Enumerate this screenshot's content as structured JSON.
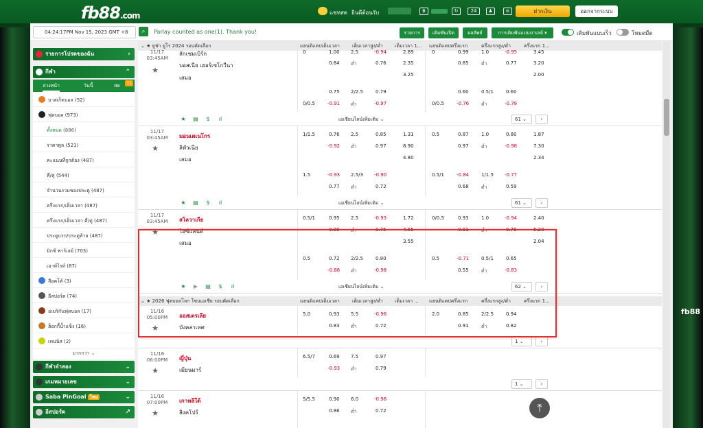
{
  "header": {
    "logo": "fb88",
    "logo_suffix": ".com",
    "chat_label": "แชทสด",
    "welcome": "ยินดีต้อนรับ",
    "deposit": "ฝากเงิน",
    "logout": "ออกจากระบบ"
  },
  "topbar": {
    "time": "04:24:17PM Nov 15, 2023 GMT +8",
    "parlay_msg": "Parlay counted as one(1). Thank you!",
    "btn_rules": "รายการ",
    "btn_open": "เดิมพันเปิด",
    "btn_results": "ผลลัพธ์",
    "btn_bet_type": "การเดิมพันแบบมาเลย์",
    "toggle_fast": "เดิมพันแบบเร็ว",
    "toggle_dark": "โหมดมืด"
  },
  "sidebar": {
    "fav_list": "รายการโปรดของฉัน",
    "sports": "กีฬา",
    "tabs": [
      "ล่วงหน้า",
      "วันนี้",
      "สด"
    ],
    "live_count": "11",
    "rows": [
      {
        "label": "บาสเก็ตบอล",
        "count": "(52)"
      },
      {
        "label": "ฟุตบอล",
        "count": "(973)"
      },
      {
        "label": "ทั้งหมด",
        "count": "(886)"
      },
      {
        "label": "ราคาพูล",
        "count": "(521)"
      },
      {
        "label": "คะแนนที่ถูกต้อง",
        "count": "(487)"
      },
      {
        "label": "คี่/คู่",
        "count": "(544)"
      },
      {
        "label": "จำนวนรวมของประตู",
        "count": "(487)"
      },
      {
        "label": "ครึ่งแรก/เต็มเวลา",
        "count": "(487)"
      },
      {
        "label": "ครึ่งแรก/เต็มเวลา คี่/คู่",
        "count": "(487)"
      },
      {
        "label": "ประตูแรก/ประตูท้าย",
        "count": "(487)"
      },
      {
        "label": "มิกซ์ พาร์เลย์",
        "count": "(703)"
      },
      {
        "label": "เอาท์ไรท์",
        "count": "(87)"
      },
      {
        "label": "ลีอคโต้",
        "count": "(3)"
      },
      {
        "label": "อีสปอร์ต",
        "count": "(74)"
      },
      {
        "label": "อเมริกันฟุตบอล",
        "count": "(17)"
      },
      {
        "label": "ฮ็อกกี้น้ำแข็ง",
        "count": "(16)"
      },
      {
        "label": "เทนนิส",
        "count": "(2)"
      }
    ],
    "more": "มากกว่า",
    "virtual": "กีฬาจำลอง",
    "number_game": "เกมหมายเลข",
    "saba": "Saba PinGoal",
    "saba_badge": "ใหม่",
    "esports": "อีสปอร์ต"
  },
  "odds": {
    "league1": "ยูฟ่า ยูโร 2024 รอบคัดเลือก",
    "league2": "2026 ฟุตบอลโลก โซนเอเชีย รอบคัดเลือก",
    "col_heads": [
      "แฮนดิแคปเต็มเวลา",
      "เต็มเวลาสูง/ต่ำ",
      "เต็มเวลา 1...",
      "แฮนดิแคปครึ่งแรก",
      "ครึ่งแรกสูง/ต่ำ",
      "ครึ่งแรก 1..."
    ],
    "col_heads2": [
      "แฮนดิแคปเต็มเวลา",
      "เต็มเวลาสูง/ต่ำ",
      "เต็มเวลา ...",
      "แฮนดิแคปครึ่งแรก",
      "ครึ่งแรกสูง/ต่ำ",
      "ครึ่งแรก 1..."
    ],
    "low": "ต่ำ",
    "draw": "เสมอ",
    "more_bets": "เอเชียนไลน์เพิ่มเติม",
    "m0": {
      "time": "11/17",
      "clock": "03:45AM",
      "home": "ลักเซมเบิร์ก",
      "away": "บอสเนีย เฮอร์เซโกวีนา",
      "r1": [
        "0",
        "1.00",
        "2.5",
        "-0.94",
        "2.89",
        "0",
        "0.99",
        "1.0",
        "-0.95",
        "3.45"
      ],
      "r2": [
        "0.84",
        "0.76",
        "2.35",
        "0.85",
        "0.77",
        "3.20"
      ],
      "r3": [
        "3.25",
        "2.00"
      ],
      "a1": [
        "0.75",
        "2/2.5",
        "0.79",
        "0.60",
        "0.5/1",
        "0.60"
      ],
      "a2": [
        "0/0.5",
        "-0.91",
        "-0.97",
        "0/0.5",
        "-0.76",
        "-0.78"
      ],
      "count": "61"
    },
    "m1": {
      "time": "11/17",
      "clock": "03:45AM",
      "home": "มอนเตเนโกร",
      "away": "ลิทัวเนีย",
      "r1": [
        "1/1.5",
        "0.76",
        "2.5",
        "0.85",
        "1.31",
        "0.5",
        "0.87",
        "1.0",
        "0.80",
        "1.87"
      ],
      "r2": [
        "-0.92",
        "0.97",
        "8.90",
        "0.97",
        "-0.98",
        "7.30"
      ],
      "r3": [
        "4.80",
        "2.34"
      ],
      "a1": [
        "1.5",
        "-0.93",
        "2.5/3",
        "-0.90",
        "0.5/1",
        "-0.84",
        "1/1.5",
        "-0.77"
      ],
      "a2": [
        "0.77",
        "0.72",
        "0.68",
        "0.59"
      ],
      "count": "61"
    },
    "m2": {
      "time": "11/17",
      "clock": "03:45AM",
      "home": "สโลวาเกีย",
      "away": "ไอซ์แลนด์",
      "r1": [
        "0.5/1",
        "0.95",
        "2.5",
        "-0.93",
        "1.72",
        "0/0.5",
        "0.93",
        "1.0",
        "-0.94",
        "2.40"
      ],
      "r2": [
        "0.89",
        "0.75",
        "4.65",
        "0.91",
        "0.76",
        "5.20"
      ],
      "r3": [
        "3.55",
        "2.04"
      ],
      "a1": [
        "0.5",
        "0.72",
        "2/2.5",
        "0.80",
        "0.5",
        "-0.71",
        "0.5/1",
        "0.65"
      ],
      "a2": [
        "-0.88",
        "-0.98",
        "0.55",
        "-0.83"
      ],
      "count": "62"
    },
    "m3": {
      "time": "11/16",
      "clock": "05:00PM",
      "home": "ออสเตรเลีย",
      "away": "บังคลาเทศ",
      "r1": [
        "5.0",
        "0.93",
        "5.5",
        "-0.96",
        "2.0",
        "0.85",
        "2/2.5",
        "0.94"
      ],
      "r2": [
        "0.83",
        "0.72",
        "0.91",
        "0.82"
      ],
      "count": "1"
    },
    "m4": {
      "time": "11/16",
      "clock": "06:00PM",
      "home": "ญี่ปุ่น",
      "away": "เมียนมาร์",
      "r1": [
        "6.5/7",
        "0.69",
        "7.5",
        "0.97"
      ],
      "r2": [
        "-0.93",
        "0.79"
      ],
      "count": "1"
    },
    "m5": {
      "time": "11/16",
      "clock": "07:00PM",
      "home": "เกาหลีใต้",
      "away": "สิงคโปร์",
      "r1": [
        "5/5.5",
        "0.90",
        "6.0",
        "-0.96"
      ],
      "r2": [
        "0.86",
        "0.72"
      ]
    }
  },
  "colors": {
    "brand": "#1b8a3b",
    "negative": "#d0021b",
    "highlight": "#e03131",
    "deposit": "#f0a700"
  }
}
